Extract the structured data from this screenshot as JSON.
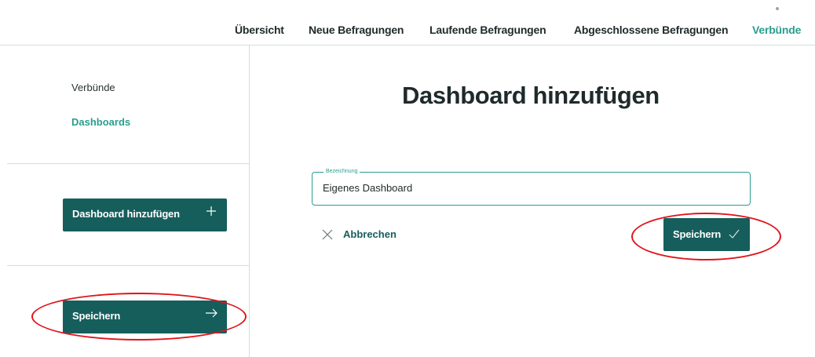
{
  "nav": {
    "items": [
      {
        "label": "Übersicht"
      },
      {
        "label": "Neue Befragungen"
      },
      {
        "label": "Laufende Befragungen"
      },
      {
        "label": "Abgeschlossene Befragungen"
      },
      {
        "label": "Verbünde"
      }
    ],
    "active_index": 4
  },
  "sidebar": {
    "links": [
      {
        "label": "Verbünde"
      },
      {
        "label": "Dashboards"
      }
    ],
    "add_button": {
      "label": "Dashboard hinzufügen",
      "icon": "plus-icon"
    },
    "save_button": {
      "label": "Speichern",
      "icon": "arrow-right-icon"
    }
  },
  "main": {
    "title": "Dashboard hinzufügen",
    "field": {
      "label": "Bezeichnung",
      "value": "Eigenes Dashboard"
    },
    "cancel_label": "Abbrechen",
    "save_label": "Speichern"
  },
  "colors": {
    "accent": "#2a9d8f",
    "button": "#155e5c",
    "annotation": "#e0141a"
  }
}
